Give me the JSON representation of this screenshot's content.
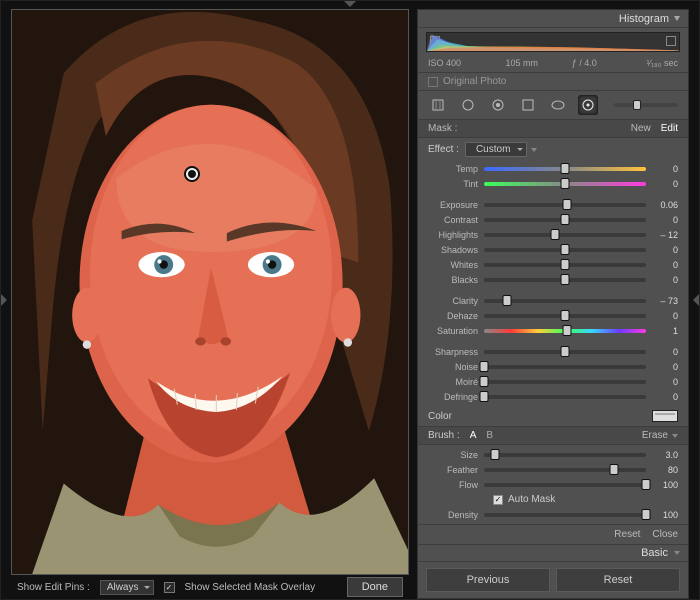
{
  "panels": {
    "histogram_title": "Histogram",
    "basic_title": "Basic"
  },
  "histogram": {
    "iso": "ISO 400",
    "focal": "105 mm",
    "aperture": "ƒ / 4.0",
    "shutter": "¹⁄₁₈₀ sec",
    "original_photo": "Original Photo"
  },
  "mask": {
    "label": "Mask :",
    "new": "New",
    "edit": "Edit"
  },
  "effect": {
    "label": "Effect :",
    "value": "Custom"
  },
  "sliders": {
    "temp": {
      "name": "Temp",
      "value": "0",
      "pos": 50
    },
    "tint": {
      "name": "Tint",
      "value": "0",
      "pos": 50
    },
    "exposure": {
      "name": "Exposure",
      "value": "0.06",
      "pos": 51
    },
    "contrast": {
      "name": "Contrast",
      "value": "0",
      "pos": 50
    },
    "highlights": {
      "name": "Highlights",
      "value": "– 12",
      "pos": 44
    },
    "shadows": {
      "name": "Shadows",
      "value": "0",
      "pos": 50
    },
    "whites": {
      "name": "Whites",
      "value": "0",
      "pos": 50
    },
    "blacks": {
      "name": "Blacks",
      "value": "0",
      "pos": 50
    },
    "clarity": {
      "name": "Clarity",
      "value": "– 73",
      "pos": 14
    },
    "dehaze": {
      "name": "Dehaze",
      "value": "0",
      "pos": 50
    },
    "saturation": {
      "name": "Saturation",
      "value": "1",
      "pos": 51
    },
    "sharpness": {
      "name": "Sharpness",
      "value": "0",
      "pos": 50
    },
    "noise": {
      "name": "Noise",
      "value": "0",
      "pos": 0
    },
    "moire": {
      "name": "Moiré",
      "value": "0",
      "pos": 0
    },
    "defringe": {
      "name": "Defringe",
      "value": "0",
      "pos": 0
    }
  },
  "color": {
    "label": "Color"
  },
  "brush": {
    "label": "Brush :",
    "a": "A",
    "b": "B",
    "erase": "Erase",
    "size": {
      "name": "Size",
      "value": "3.0",
      "pos": 7
    },
    "feather": {
      "name": "Feather",
      "value": "80",
      "pos": 80
    },
    "flow": {
      "name": "Flow",
      "value": "100",
      "pos": 100
    },
    "automask": {
      "label": "Auto Mask",
      "checked": true
    },
    "density": {
      "name": "Density",
      "value": "100",
      "pos": 100
    }
  },
  "footer": {
    "reset": "Reset",
    "close": "Close",
    "previous": "Previous",
    "reset_btn": "Reset"
  },
  "photo_toolbar": {
    "show_pins_label": "Show Edit Pins :",
    "show_pins_value": "Always",
    "mask_overlay": "Show Selected Mask Overlay",
    "done": "Done"
  }
}
